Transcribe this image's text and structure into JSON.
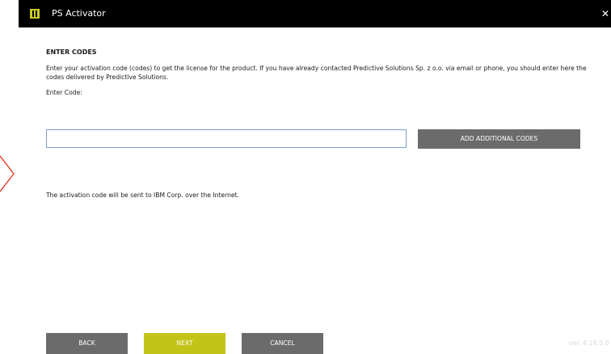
{
  "window": {
    "title": "PS Activator",
    "close_symbol": "✕"
  },
  "content": {
    "heading": "ENTER CODES",
    "description": "Enter your activation code (codes) to get the license for the product. If you have already contacted Predictive Solutions Sp. z o.o. via email or phone, you should enter here the codes delivered by Predictive Solutions.",
    "code_label": "Enter Code:",
    "code_input_value": "",
    "add_codes_label": "ADD ADDITIONAL CODES",
    "notice": "The activation code will be sent to IBM Corp. over the Internet."
  },
  "footer": {
    "back_label": "BACK",
    "next_label": "NEXT",
    "cancel_label": "CANCEL",
    "version": "ver. 4.18.0.0"
  },
  "icons": {
    "app_icon": "ps-activator-icon",
    "close_icon": "close-icon",
    "side_icon": "chevron-right-icon"
  },
  "colors": {
    "titlebar": "#000000",
    "accent": "#c3c418",
    "button_gray": "#6b6b6b",
    "input_border": "#7a9fcf",
    "chevron": "#e0301e",
    "version_text": "#d8d8d8"
  }
}
